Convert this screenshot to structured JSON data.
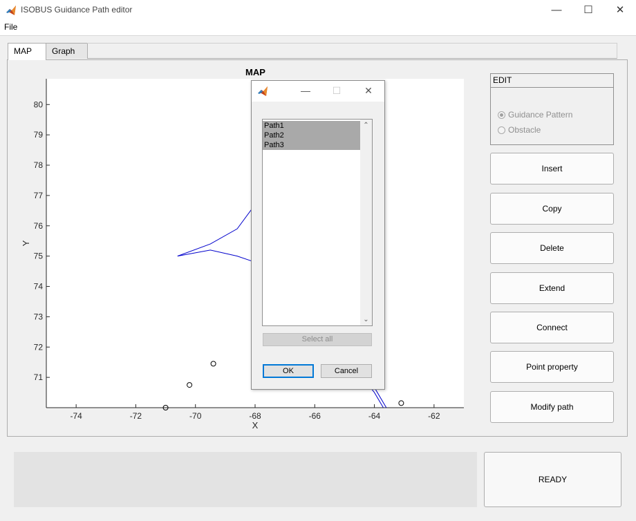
{
  "window": {
    "title": "ISOBUS Guidance Path editor",
    "controls": {
      "minimize": "—",
      "maximize": "☐",
      "close": "✕"
    }
  },
  "menu": {
    "file": "File"
  },
  "tabs": [
    {
      "label": "MAP",
      "active": true
    },
    {
      "label": "Graph",
      "active": false
    }
  ],
  "chart_data": {
    "type": "scatter",
    "title": "MAP",
    "xlabel": "X",
    "ylabel": "Y",
    "xlim": [
      -75,
      -61
    ],
    "ylim": [
      70,
      80.85
    ],
    "xticks": [
      "-74",
      "-72",
      "-70",
      "-68",
      "-66",
      "-64",
      "-62"
    ],
    "yticks": [
      "80",
      "79",
      "78",
      "77",
      "76",
      "75",
      "74",
      "73",
      "72",
      "71"
    ],
    "grid": false,
    "series": [
      {
        "kind": "markers",
        "marker": "circle-open",
        "color": "#000000",
        "points": [
          [
            -71.0,
            70.0
          ],
          [
            -70.2,
            70.75
          ],
          [
            -69.4,
            71.45
          ],
          [
            -68.0,
            72.6
          ],
          [
            -63.1,
            70.15
          ]
        ]
      },
      {
        "kind": "curves",
        "color": "#0000cc",
        "paths": [
          [
            [
              -70.6,
              75.0
            ],
            [
              -69.5,
              75.4
            ],
            [
              -68.6,
              75.9
            ],
            [
              -68.0,
              76.7
            ]
          ],
          [
            [
              -70.6,
              75.0
            ],
            [
              -69.5,
              75.2
            ],
            [
              -68.6,
              75.0
            ],
            [
              -68.0,
              74.8
            ]
          ],
          [
            [
              -64.4,
              71.0
            ],
            [
              -64.0,
              70.5
            ],
            [
              -63.7,
              70.0
            ]
          ],
          [
            [
              -64.2,
              71.0
            ],
            [
              -63.9,
              70.5
            ],
            [
              -63.6,
              70.0
            ]
          ]
        ]
      }
    ]
  },
  "edit_panel": {
    "title": "EDIT",
    "options": [
      {
        "label": "Guidance Pattern",
        "checked": true
      },
      {
        "label": "Obstacle",
        "checked": false
      }
    ]
  },
  "buttons": {
    "insert": "Insert",
    "copy": "Copy",
    "delete": "Delete",
    "extend": "Extend",
    "connect": "Connect",
    "point_property": "Point property",
    "modify_path": "Modify path"
  },
  "status": {
    "ready": "READY"
  },
  "dialog": {
    "items": [
      "Path1",
      "Path2",
      "Path3"
    ],
    "select_all": "Select all",
    "ok": "OK",
    "cancel": "Cancel",
    "controls": {
      "minimize": "—",
      "maximize": "☐",
      "close": "✕"
    }
  },
  "colors": {
    "accent": "#0078d7",
    "selection": "#a9a9a9",
    "curve": "#0000cc"
  }
}
